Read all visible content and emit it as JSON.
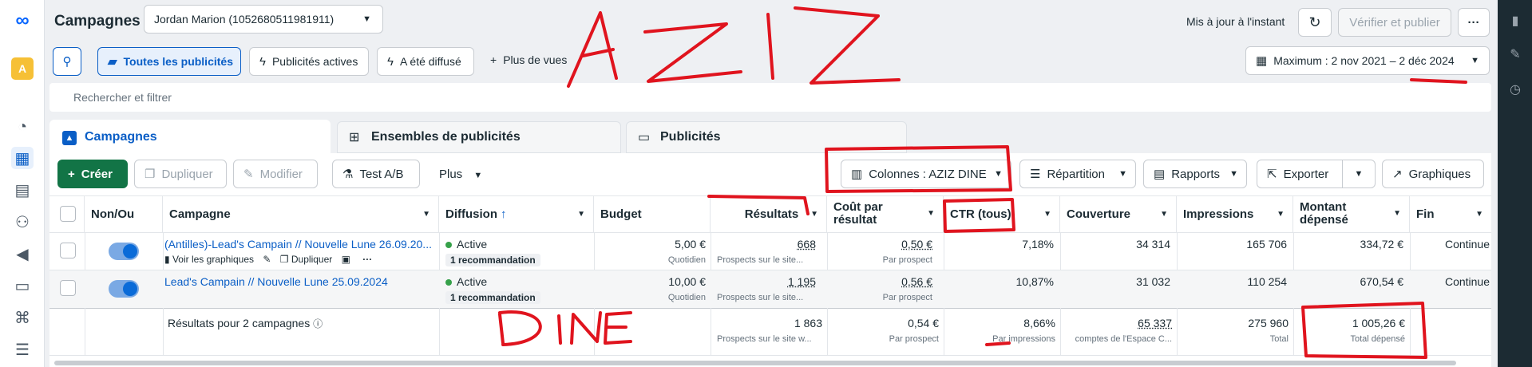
{
  "header": {
    "title": "Campagnes",
    "account": "Jordan Marion (1052680511981911)",
    "updated": "Mis à jour à l'instant",
    "verify_publish": "Vérifier et publier",
    "date_range": "Maximum : 2 nov 2021 – 2 déc 2024"
  },
  "filters": {
    "all_ads": "Toutes les publicités",
    "active_ads": "Publicités actives",
    "delivered": "A été diffusé",
    "more_views": "Plus de vues",
    "search_placeholder": "Rechercher et filtrer"
  },
  "tabs": [
    "Campagnes",
    "Ensembles de publicités",
    "Publicités"
  ],
  "toolbar": {
    "create": "Créer",
    "duplicate": "Dupliquer",
    "edit": "Modifier",
    "ab_test": "Test A/B",
    "more": "Plus",
    "columns": "Colonnes : AZIZ DINE",
    "breakdown": "Répartition",
    "reports": "Rapports",
    "export": "Exporter",
    "charts": "Graphiques"
  },
  "columns": [
    "Non/Ou",
    "Campagne",
    "Diffusion",
    "Budget",
    "Résultats",
    "Coût par résultat",
    "CTR (tous)",
    "Couverture",
    "Impressions",
    "Montant dépensé",
    "Fin"
  ],
  "rows": [
    {
      "name": "(Antilles)-Lead's Campain // Nouvelle Lune 26.09.20...",
      "actions": [
        "Voir les graphiques",
        "Dupliquer"
      ],
      "status": "Active",
      "recommendation": "1 recommandation",
      "budget": "5,00 €",
      "budget_type": "Quotidien",
      "results": "668",
      "results_sub": "Prospects sur le site...",
      "cost": "0,50 €",
      "cost_sub": "Par prospect",
      "ctr": "7,18%",
      "reach": "34 314",
      "impressions": "165 706",
      "spent": "334,72 €",
      "end": "Continue"
    },
    {
      "name": "Lead's Campain // Nouvelle Lune 25.09.2024",
      "status": "Active",
      "recommendation": "1 recommandation",
      "budget": "10,00 €",
      "budget_type": "Quotidien",
      "results": "1 195",
      "results_sub": "Prospects sur le site...",
      "cost": "0,56 €",
      "cost_sub": "Par prospect",
      "ctr": "10,87%",
      "reach": "31 032",
      "impressions": "110 254",
      "spent": "670,54 €",
      "end": "Continue"
    }
  ],
  "totals": {
    "label": "Résultats pour 2 campagnes",
    "results": "1 863",
    "results_sub": "Prospects sur le site w...",
    "cost": "0,54 €",
    "cost_sub": "Par prospect",
    "ctr": "8,66%",
    "ctr_sub": "Par impressions",
    "reach": "65 337",
    "reach_sub": "comptes de l'Espace C...",
    "impressions": "275 960",
    "impressions_sub": "Total",
    "spent": "1 005,26 €",
    "spent_sub": "Total dépensé"
  },
  "annotations": [
    "AZIZ",
    "DINE"
  ],
  "colors": {
    "accent": "#0a5ec6",
    "create_green": "#127446",
    "annotation_red": "#e0141e"
  }
}
